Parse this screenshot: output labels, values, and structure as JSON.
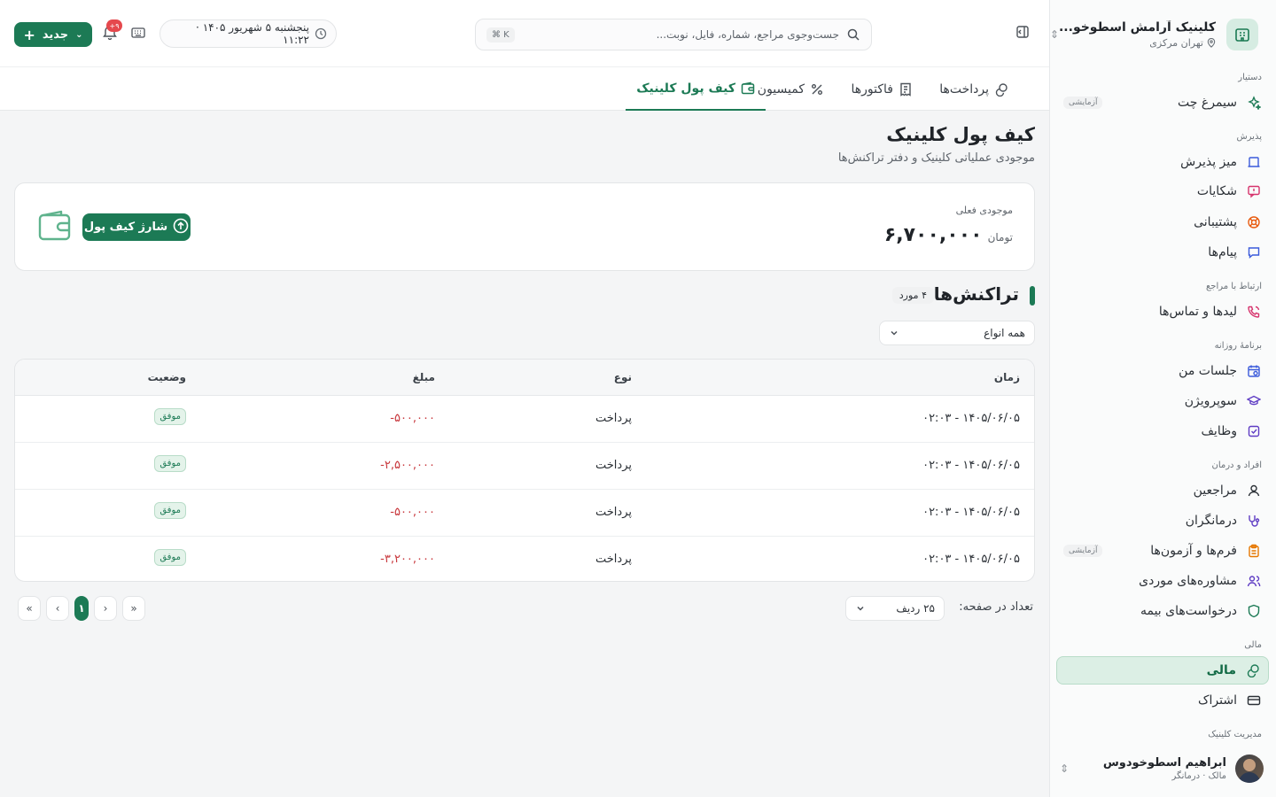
{
  "sidebar": {
    "clinic_name": "کلینیک آرامش اسطوخو...",
    "clinic_location": "تهران مرکزی",
    "sections": {
      "assistant": "دستیار",
      "reception": "پذیرش",
      "clients": "ارتباط با مراجع",
      "daily": "برنامهٔ روزانه",
      "people": "افراد و درمان",
      "finance": "مالی",
      "admin": "مدیریت کلینیک"
    },
    "items": {
      "chat": "سیمرغ چت",
      "chat_tag": "آزمایشی",
      "front_desk": "میز پذیرش",
      "complaints": "شکایات",
      "support": "پشتیبانی",
      "messages": "پیام‌ها",
      "leads": "لیدها و تماس‌ها",
      "sessions": "جلسات من",
      "supervision": "سوپرویژن",
      "tasks": "وظایف",
      "clients": "مراجعین",
      "therapists": "درمانگران",
      "forms": "فرم‌ها و آزمون‌ها",
      "forms_tag": "آزمایشی",
      "cases": "مشاوره‌های موردی",
      "insurance": "درخواست‌های بیمه",
      "finance": "مالی",
      "subscription": "اشتراک"
    },
    "user": {
      "name": "ابراهیم اسطوخودوس",
      "role": "مالک · درمانگر"
    }
  },
  "topbar": {
    "search_placeholder": "جست‌وجوی مراجع، شماره، فایل، نوبت...",
    "search_shortcut": "⌘ K",
    "datetime": "پنجشنبه ۵ شهریور ۱۴۰۵ · ۱۱:۲۲",
    "notifications": "۹+",
    "new_label": "جدید"
  },
  "tabs": {
    "payments": "پرداخت‌ها",
    "invoices": "فاکتورها",
    "commission": "کمیسیون",
    "wallet": "کیف پول کلینیک"
  },
  "page": {
    "title": "کیف پول کلینیک",
    "subtitle": "موجودی عملیاتی کلینیک و دفتر تراکنش‌ها"
  },
  "balance": {
    "label": "موجودی فعلی",
    "amount": "۶,۷۰۰,۰۰۰",
    "unit": "تومان",
    "charge_label": "شارژ کیف پول"
  },
  "transactions": {
    "title": "تراکنش‌ها",
    "count": "۴ مورد",
    "filter": "همه انواع",
    "columns": {
      "time": "زمان",
      "type": "نوع",
      "amount": "مبلغ",
      "status": "وضعیت"
    },
    "rows": [
      {
        "time": "۱۴۰۵/۰۶/۰۵ - ۰۲:۰۳",
        "type": "پرداخت",
        "amount": "-۵۰۰,۰۰۰",
        "status": "موفق"
      },
      {
        "time": "۱۴۰۵/۰۶/۰۵ - ۰۲:۰۳",
        "type": "پرداخت",
        "amount": "-۲,۵۰۰,۰۰۰",
        "status": "موفق"
      },
      {
        "time": "۱۴۰۵/۰۶/۰۵ - ۰۲:۰۳",
        "type": "پرداخت",
        "amount": "-۵۰۰,۰۰۰",
        "status": "موفق"
      },
      {
        "time": "۱۴۰۵/۰۶/۰۵ - ۰۲:۰۳",
        "type": "پرداخت",
        "amount": "-۳,۲۰۰,۰۰۰",
        "status": "موفق"
      }
    ]
  },
  "pagination": {
    "per_page_label": "تعداد در صفحه:",
    "per_page_value": "۲۵ ردیف",
    "current_page": "۱"
  },
  "colors": {
    "accent": "#1c7a55",
    "negative": "#c8373c",
    "success_bg": "#e4f3ea"
  }
}
